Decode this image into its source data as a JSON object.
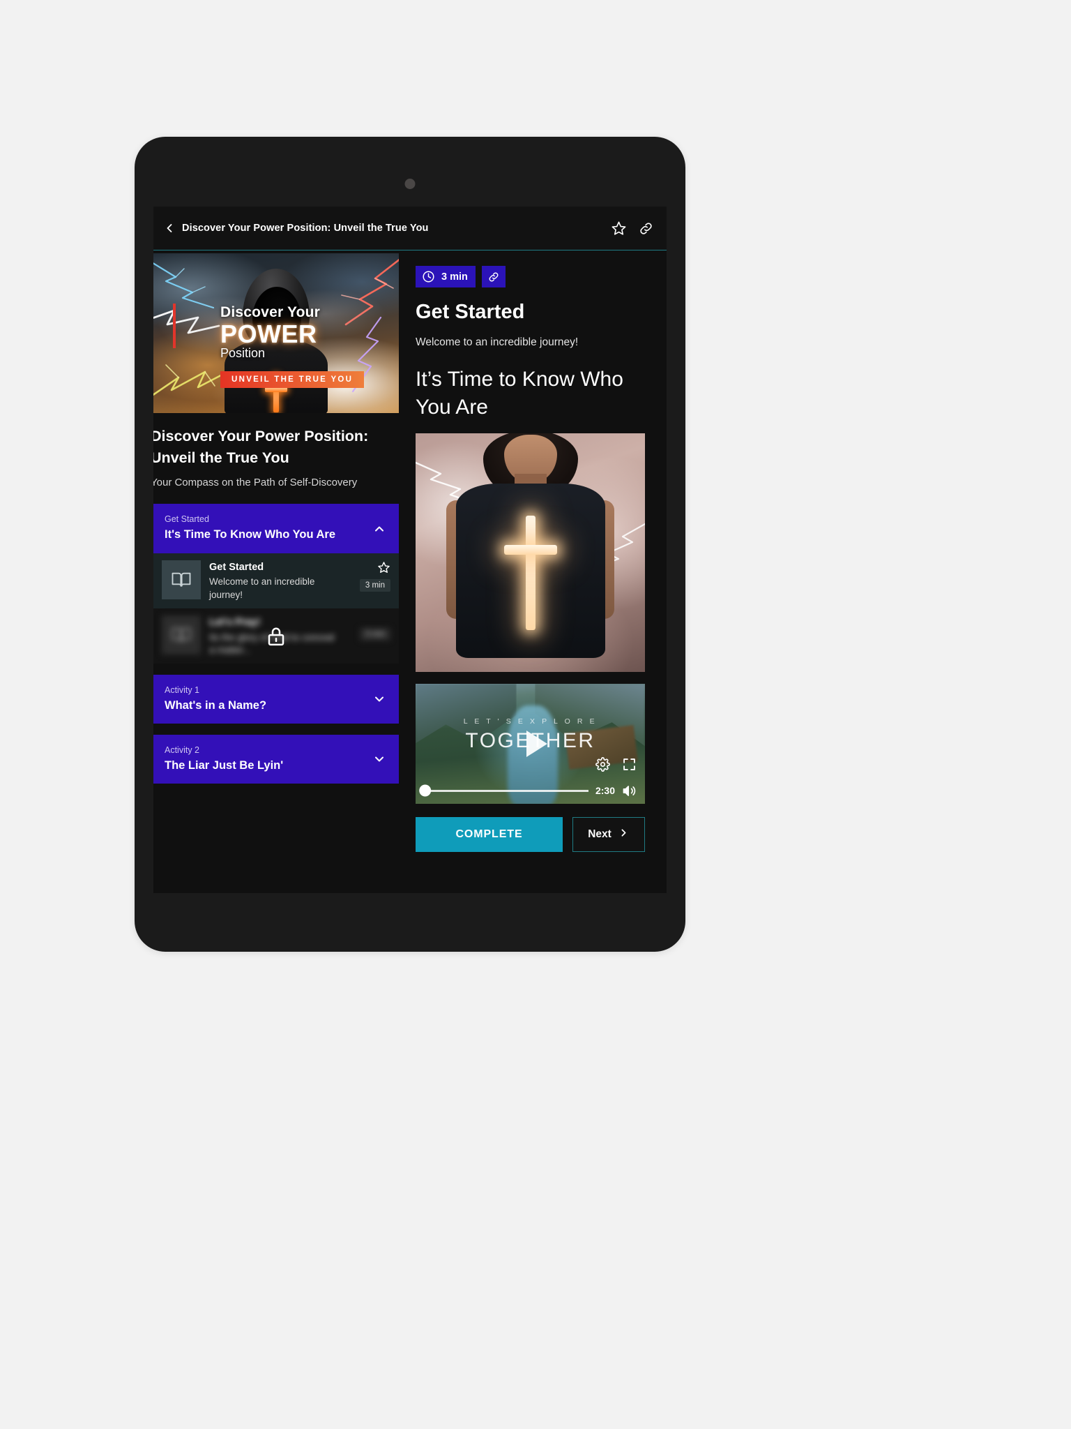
{
  "appbar": {
    "back_icon": "chevron-left-icon",
    "title": "Discover Your Power Position: Unveil the True You",
    "favorite_icon": "star-outline-icon",
    "share_icon": "link-icon"
  },
  "course": {
    "hero": {
      "line1": "Discover Your",
      "line2": "POWER",
      "line3": "Position",
      "badge": "UNVEIL THE TRUE YOU"
    },
    "title": "Discover Your Power Position: Unveil the True You",
    "subtitle": "Your Compass on the Path of Self-Discovery"
  },
  "lessons": [
    {
      "kicker": "Get Started",
      "title": "It's Time To Know Who You Are",
      "expanded": true,
      "chevron": "chevron-up-icon",
      "items": [
        {
          "icon": "book-icon",
          "title": "Get Started",
          "desc": "Welcome to an incredible journey!",
          "duration": "3 min",
          "star_icon": "star-outline-icon",
          "locked": false
        },
        {
          "icon": "book-icon",
          "title": "Let's Pray!",
          "desc": "Its the glory of God to conceal a matter...",
          "duration": "3 min",
          "lock_icon": "lock-icon",
          "locked": true
        }
      ]
    },
    {
      "kicker": "Activity 1",
      "title": "What's in a Name?",
      "expanded": false,
      "chevron": "chevron-down-icon",
      "items": []
    },
    {
      "kicker": "Activity 2",
      "title": "The Liar Just Be Lyin'",
      "expanded": false,
      "chevron": "chevron-down-icon",
      "items": []
    }
  ],
  "lesson_detail": {
    "duration_badge": "3 min",
    "clock_icon": "clock-icon",
    "link_icon": "link-icon",
    "heading": "Get Started",
    "intro": "Welcome to an incredible journey!",
    "subheading": "It’s Time to Know Who You Are",
    "image_alt": "woman-lightning-cross-shirt"
  },
  "video": {
    "overlay_small": "L E T ' S   E X P L O R E",
    "overlay_big": "TOGETHER",
    "play_icon": "play-icon",
    "settings_icon": "gear-icon",
    "fullscreen_icon": "fullscreen-icon",
    "timestamp": "2:30",
    "volume_icon": "volume-icon",
    "progress_percent": 0
  },
  "actions": {
    "complete_label": "COMPLETE",
    "next_label": "Next",
    "next_icon": "chevron-right-icon"
  },
  "colors": {
    "accent_purple": "#3310b8",
    "accent_teal": "#0f9cba",
    "border_teal": "#1f7b84",
    "bg_dark": "#101010"
  }
}
